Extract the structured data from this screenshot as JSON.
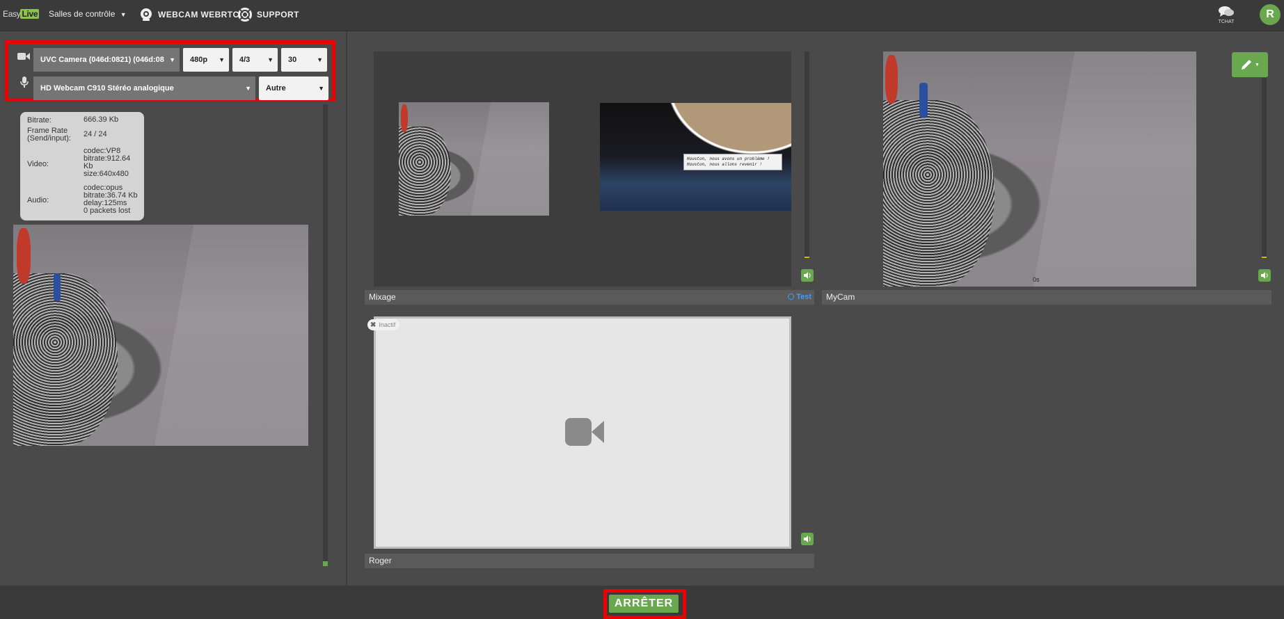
{
  "topbar": {
    "logo": {
      "part1": "Easy",
      "part2": "Live"
    },
    "rooms_menu": "Salles de contrôle",
    "nav_webcam": "WEBCAM WEBRTC",
    "nav_support": "SUPPORT",
    "chat_label": "TCHAT",
    "avatar_initial": "R"
  },
  "controls": {
    "camera_select": "UVC Camera (046d:0821) (046d:08",
    "resolution_select": "480p",
    "ratio_select": "4/3",
    "fps_select": "30",
    "mic_select": "HD Webcam C910 Stéréo analogique",
    "audio_type_select": "Autre"
  },
  "stats": {
    "bitrate_label": "Bitrate:",
    "bitrate_value": "666.39 Kb",
    "framerate_label": "Frame Rate (Send/input):",
    "framerate_value": "24 / 24",
    "video_label": "Video:",
    "video_codec": "codec:VP8",
    "video_bitrate": "bitrate:912.64",
    "video_bitrate_unit": "Kb",
    "video_size": "size:640x480",
    "audio_label": "Audio:",
    "audio_codec": "codec:opus",
    "audio_bitrate": "bitrate:36.74 Kb",
    "audio_delay": "delay:125ms",
    "audio_lost": "0 packets lost"
  },
  "mixage": {
    "label": "Mixage",
    "test_label": "Test",
    "bubble_line1": "Houston, nous avons un problème !",
    "bubble_line2": "Houston, nous allons revenir !"
  },
  "mycam": {
    "label": "MyCam",
    "timer": "0s"
  },
  "roger": {
    "label": "Roger",
    "status": "Inactif"
  },
  "footer": {
    "stop_button": "ARRÊTER"
  },
  "colors": {
    "accent_green": "#6aa84f",
    "highlight_red": "#ee0000",
    "test_blue": "#3aa0ff"
  }
}
